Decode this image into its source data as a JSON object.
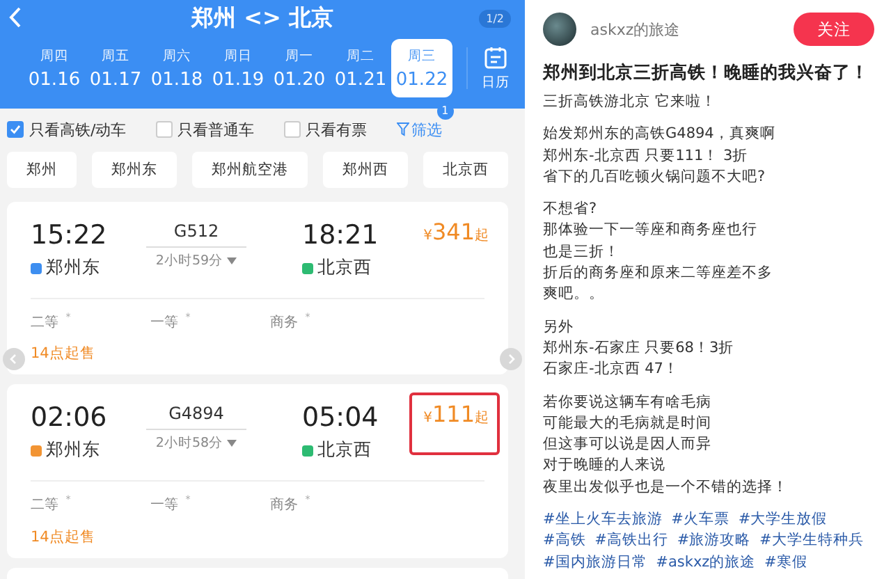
{
  "header": {
    "title": "郑州 <> 北京",
    "page_badge": "1/2"
  },
  "dates": [
    {
      "weekday": "周四",
      "date": "01.16",
      "selected": false
    },
    {
      "weekday": "周五",
      "date": "01.17",
      "selected": false
    },
    {
      "weekday": "周六",
      "date": "01.18",
      "selected": false
    },
    {
      "weekday": "周日",
      "date": "01.19",
      "selected": false
    },
    {
      "weekday": "周一",
      "date": "01.20",
      "selected": false
    },
    {
      "weekday": "周二",
      "date": "01.21",
      "selected": false
    },
    {
      "weekday": "周三",
      "date": "01.22",
      "selected": true
    }
  ],
  "calendar": {
    "label": "日历"
  },
  "filters": [
    {
      "label": "只看高铁/动车",
      "checked": true
    },
    {
      "label": "只看普通车",
      "checked": false
    },
    {
      "label": "只看有票",
      "checked": false
    }
  ],
  "screen": {
    "label": "筛选",
    "badge": "1"
  },
  "stations": [
    "郑州",
    "郑州东",
    "郑州航空港",
    "郑州西",
    "北京西"
  ],
  "trains": [
    {
      "depart": "15:22",
      "number": "G512",
      "arrive": "18:21",
      "duration": "2小时59分",
      "from": {
        "name": "郑州东",
        "color": "#3d8ef0"
      },
      "to": {
        "name": "北京西",
        "color": "#2dbb72"
      },
      "currency": "¥",
      "price": "341",
      "price_suffix": "起",
      "seats": [
        {
          "label": "二等",
          "mark": "*"
        },
        {
          "label": "一等",
          "mark": "*"
        },
        {
          "label": "商务",
          "mark": "*"
        }
      ],
      "sale": "14点起售",
      "highlighted": false,
      "carousel_arrows": true
    },
    {
      "depart": "02:06",
      "number": "G4894",
      "arrive": "05:04",
      "duration": "2小时58分",
      "from": {
        "name": "郑州东",
        "color": "#f29433"
      },
      "to": {
        "name": "北京西",
        "color": "#2dbb72"
      },
      "currency": "¥",
      "price": "111",
      "price_suffix": "起",
      "seats": [
        {
          "label": "二等",
          "mark": "*"
        },
        {
          "label": "一等",
          "mark": "*"
        },
        {
          "label": "商务",
          "mark": "*"
        }
      ],
      "sale": "14点起售",
      "highlighted": true,
      "carousel_arrows": false
    }
  ],
  "post": {
    "author": "askxz的旅途",
    "follow": "关注",
    "title": "郑州到北京三折高铁！晚睡的我兴奋了！",
    "paragraphs": [
      [
        "三折高铁游北京 它来啦！"
      ],
      [
        "始发郑州东的高铁G4894，真爽啊",
        "郑州东-北京西  只要111！ 3折",
        "省下的几百吃顿火锅问题不大吧?"
      ],
      [
        "不想省?",
        "那体验一下一等座和商务座也行",
        "也是三折！",
        "折后的商务座和原来二等座差不多",
        "爽吧。。"
      ],
      [
        "另外",
        "郑州东-石家庄 只要68！3折",
        "石家庄-北京西  47！"
      ],
      [
        "若你要说这辆车有啥毛病",
        "可能最大的毛病就是时间",
        "但这事可以说是因人而异",
        "对于晚睡的人来说",
        "夜里出发似乎也是一个不错的选择！"
      ]
    ],
    "tags": [
      "#坐上火车去旅游",
      "#火车票",
      "#大学生放假",
      "#高铁",
      "#高铁出行",
      "#旅游攻略",
      "#大学生特种兵",
      "#国内旅游日常",
      "#askxz的旅途",
      "#寒假"
    ]
  }
}
